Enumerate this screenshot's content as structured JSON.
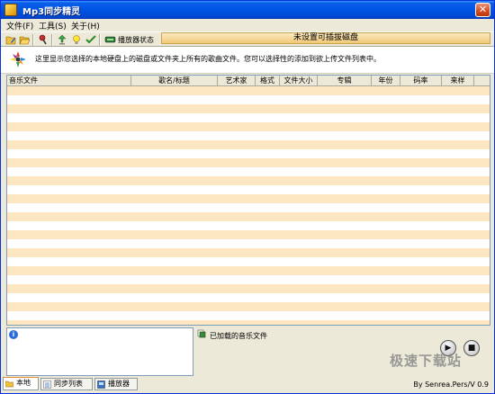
{
  "window": {
    "title": "Mp3同步精灵",
    "close_label": "✕"
  },
  "menu": [
    {
      "label": "文件(F)"
    },
    {
      "label": "工具(S)"
    },
    {
      "label": "关于(H)"
    }
  ],
  "toolbar": {
    "buttons": [
      "folder-edit-icon",
      "folder-open-icon",
      "search-device-icon",
      "upload-icon",
      "bulb-icon",
      "check-icon",
      "device-icon"
    ],
    "device_status_label": "播放器状态",
    "device_status_value": "未设置可插拔磁盘"
  },
  "info": {
    "text": "这里显示您选择的本地硬盘上的磁盘或文件夹上所有的歌曲文件。您可以选择性的添加到欲上传文件列表中。"
  },
  "table": {
    "columns": [
      {
        "label": "音乐文件",
        "align": "left"
      },
      {
        "label": "歌名/标题",
        "align": "center"
      },
      {
        "label": "艺术家",
        "align": "center"
      },
      {
        "label": "格式",
        "align": "center"
      },
      {
        "label": "文件大小",
        "align": "center"
      },
      {
        "label": "专辑",
        "align": "center"
      },
      {
        "label": "年份",
        "align": "center"
      },
      {
        "label": "码率",
        "align": "center"
      },
      {
        "label": "来样",
        "align": "center"
      }
    ],
    "rows": []
  },
  "bottom": {
    "info_glyph": "i",
    "loaded_label": "已加载的音乐文件",
    "play_glyph": "▶",
    "stop_glyph": "■"
  },
  "watermark": "极速下载站",
  "tabs": [
    {
      "label": "本地",
      "active": true
    },
    {
      "label": "同步列表",
      "active": false
    },
    {
      "label": "播放器",
      "active": false
    }
  ],
  "version": "By Senrea.Pers/V 0.9"
}
